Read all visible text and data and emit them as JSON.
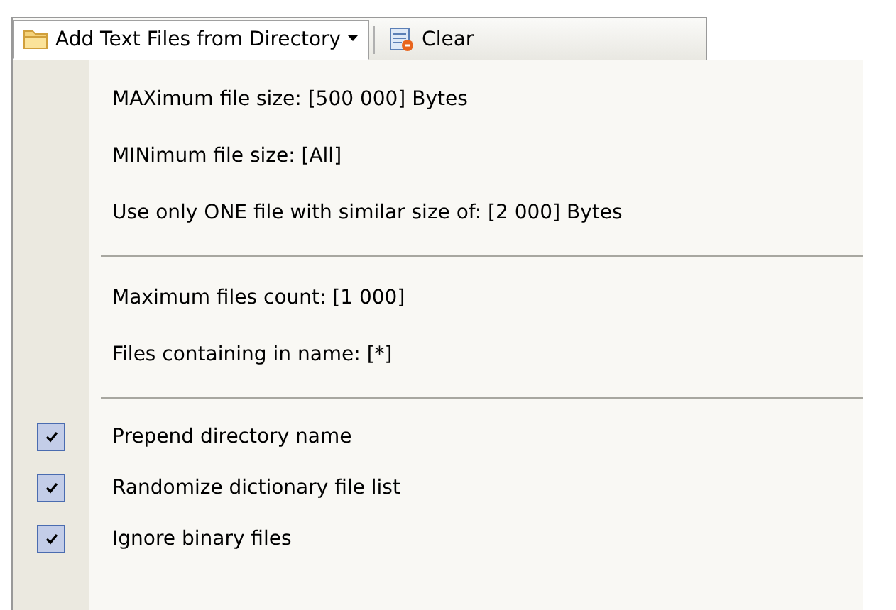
{
  "toolbar": {
    "buttons": [
      {
        "kind": "dropdown",
        "label": "Add Text Files from Directory",
        "expanded": true
      },
      {
        "kind": "plain",
        "label": "Clear",
        "expanded": false
      }
    ]
  },
  "menu": {
    "items": [
      {
        "kind": "item",
        "label": "MAXimum file size: [500 000] Bytes"
      },
      {
        "kind": "item",
        "label": "MINimum file size: [All]"
      },
      {
        "kind": "item",
        "label": "Use only ONE file with similar size of: [2 000] Bytes"
      },
      {
        "kind": "separator"
      },
      {
        "kind": "item",
        "label": "Maximum files count: [1 000]"
      },
      {
        "kind": "item",
        "label": "Files containing in name: [*]"
      },
      {
        "kind": "separator"
      },
      {
        "kind": "check",
        "label": "Prepend directory name",
        "checked": true
      },
      {
        "kind": "check",
        "label": "Randomize dictionary file list",
        "checked": true
      },
      {
        "kind": "check",
        "label": "Ignore binary files",
        "checked": true
      }
    ]
  }
}
